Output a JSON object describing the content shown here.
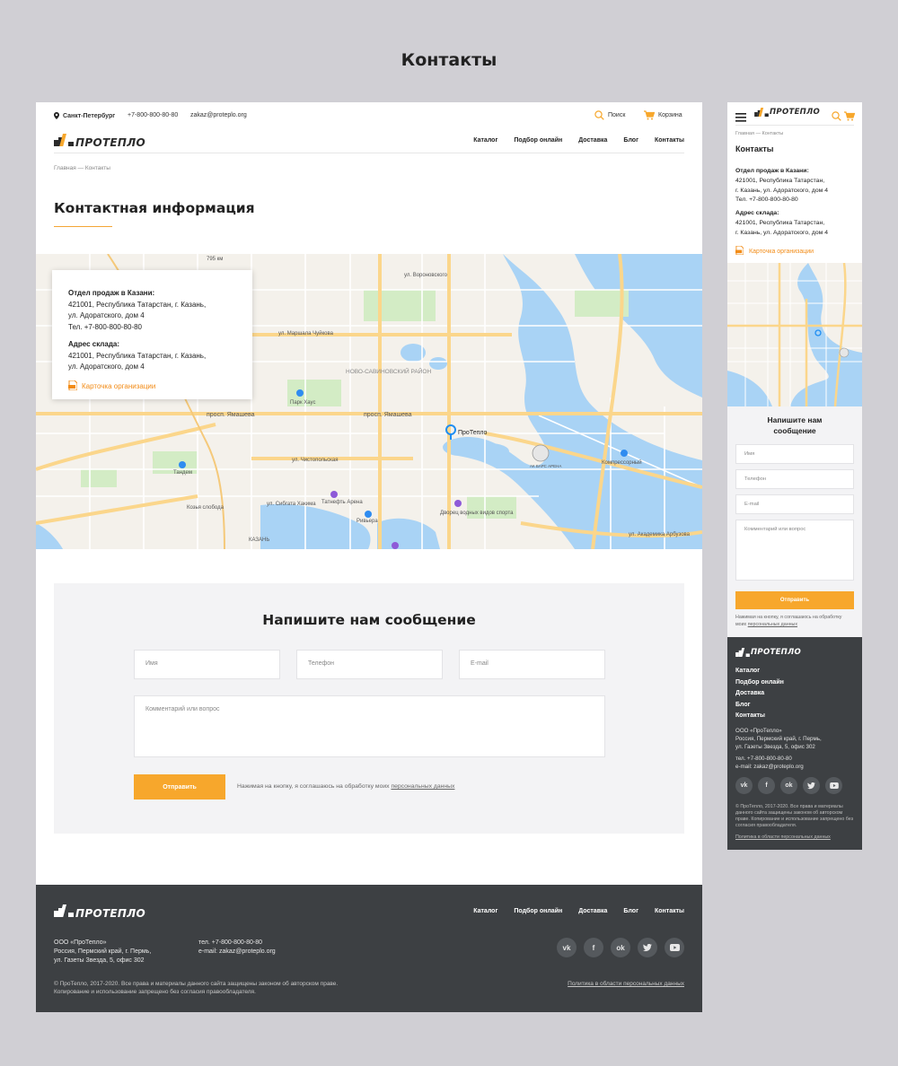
{
  "page_title": "Контакты",
  "colors": {
    "accent": "#f7a72c",
    "footer_bg": "#3d4043",
    "link": "#f28c18"
  },
  "topbar": {
    "city": "Санкт-Петербург",
    "phone": "+7-800-800-80-80",
    "email": "zakaz@proteplo.org",
    "search_label": "Поиск",
    "cart_label": "Корзина"
  },
  "logo": {
    "text": "ПРОТЕПЛО"
  },
  "nav": [
    "Каталог",
    "Подбор онлайн",
    "Доставка",
    "Блог",
    "Контакты"
  ],
  "breadcrumb": "Главная — Контакты",
  "heading": "Контактная информация",
  "contacts": {
    "sales_label": "Отдел продаж в Казани:",
    "sales_address1": "421001, Республика Татарстан, г. Казань,",
    "sales_address2": "ул. Адоратского, дом 4",
    "sales_phone": "Тел. +7-800-800-80-80",
    "warehouse_label": "Адрес склада:",
    "warehouse_address1": "421001, Республика Татарстан, г. Казань,",
    "warehouse_address2": "ул. Адоратского, дом 4",
    "card_link": "Карточка организации"
  },
  "map": {
    "marker_label": "ПроТепло",
    "labels": [
      "просп. Ямашева",
      "ул. Чистопольская",
      "ул. Вороновского",
      "Парк Хаус",
      "Тандем",
      "Козья слобода",
      "Тандем",
      "КАЗАНЬ",
      "Чистопольская",
      "ул. Сибгата Хакима",
      "Тандем",
      "Компрессорный",
      "просп. Ямашева",
      "ул. Адоратского",
      "Ривьера",
      "Дворец водных видов спорта",
      "Татнефть Арена",
      "АК БАРС АРЕНА",
      "ул. Академика Арбузова",
      "Сибирский тракт",
      "ул. Гаврилова",
      "ул. Мусина",
      "ул. Четаева",
      "НОВО-САВИНОВСКИЙ РАЙОН",
      "ул. Декабристов",
      "ул. Серова",
      "ул. Большая Крыловка",
      "Кировская дамба",
      "Казанка",
      "ул. Маршала Чуйкова",
      "795 км"
    ]
  },
  "form": {
    "title": "Напишите нам сообщение",
    "name_placeholder": "Имя",
    "phone_placeholder": "Телефон",
    "email_placeholder": "E-mail",
    "comment_placeholder": "Комментарий или вопрос",
    "submit_label": "Отправить",
    "agree_text": "Нажимая на кнопку, я соглашаюсь на обработку моих",
    "agree_link": "персональных данных"
  },
  "footer": {
    "company": "ООО «ПроТепло»",
    "address1": "Россия, Пермский край, г. Пермь,",
    "address2": "ул. Газеты Звезда, 5, офис 302",
    "phone": "тел. +7-800-800-80-80",
    "email": "e-mail: zakaz@proteplo.org",
    "socials": [
      "vk-icon",
      "facebook-icon",
      "odnoklassniki-icon",
      "twitter-icon",
      "youtube-icon"
    ],
    "copyright1": "© ПроТепло, 2017-2020. Все права и материалы данного сайта защищены законом об авторском праве.",
    "copyright2": "Копирование и использование запрещено без согласия правообладателя.",
    "policy": "Политика в области персональных данных"
  },
  "mobile": {
    "heading": "Контакты",
    "sales_address1": "421001, Республика Татарстан,",
    "sales_address2": "г. Казань, ул. Адоратского, дом 4",
    "sales_phone": "Тел. +7-800-800-80-80",
    "warehouse_address1": "421001, Республика Татарстан,",
    "warehouse_address2": "г. Казань, ул. Адоратского, дом 4",
    "form_title_line1": "Напишите нам",
    "form_title_line2": "сообщение",
    "agree_text": "Нажимая на кнопку, я соглашаюсь на обработку",
    "agree_text2": "моих",
    "footer_address1": "Россия, Пермский край, г. Пермь,",
    "footer_address2": "ул. Газеты Звезда, 5, офис 302",
    "footer_phone": "тел. +7-800-800-80-80",
    "footer_email": "e-mail: zakaz@proteplo.org",
    "copyright": "© ПроТепло, 2017-2020. Все права и материалы данного сайта защищены законом об авторском праве. Копирование и использование запрещено без согласия правообладателя."
  }
}
